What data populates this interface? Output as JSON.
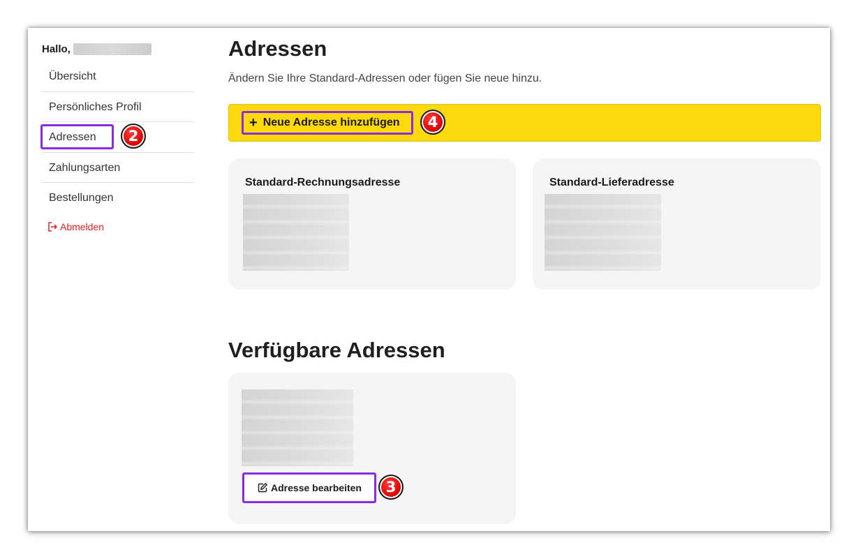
{
  "sidebar": {
    "greeting": "Hallo,",
    "items": [
      {
        "label": "Übersicht"
      },
      {
        "label": "Persönliches Profil"
      },
      {
        "label": "Adressen"
      },
      {
        "label": "Zahlungsarten"
      },
      {
        "label": "Bestellungen"
      }
    ],
    "logout_label": "Abmelden",
    "logout_icon": "logout-icon"
  },
  "main": {
    "title": "Adressen",
    "subtitle": "Ändern Sie Ihre Standard-Adressen oder fügen Sie neue hinzu.",
    "add_button_label": "Neue Adresse hinzufügen",
    "add_button_icon": "plus-icon",
    "billing_card_title": "Standard-Rechnungsadresse",
    "shipping_card_title": "Standard-Lieferadresse",
    "available_title": "Verfügbare Adressen",
    "edit_button_label": "Adresse bearbeiten",
    "edit_button_icon": "edit-icon"
  },
  "annotations": {
    "badge_sidebar": "2",
    "badge_edit": "3",
    "badge_add": "4"
  },
  "colors": {
    "accent_yellow": "#fcd90f",
    "highlight_purple": "#8a2be2",
    "badge_red": "#d40000",
    "logout_red": "#e02020",
    "card_bg": "#f5f5f5"
  }
}
